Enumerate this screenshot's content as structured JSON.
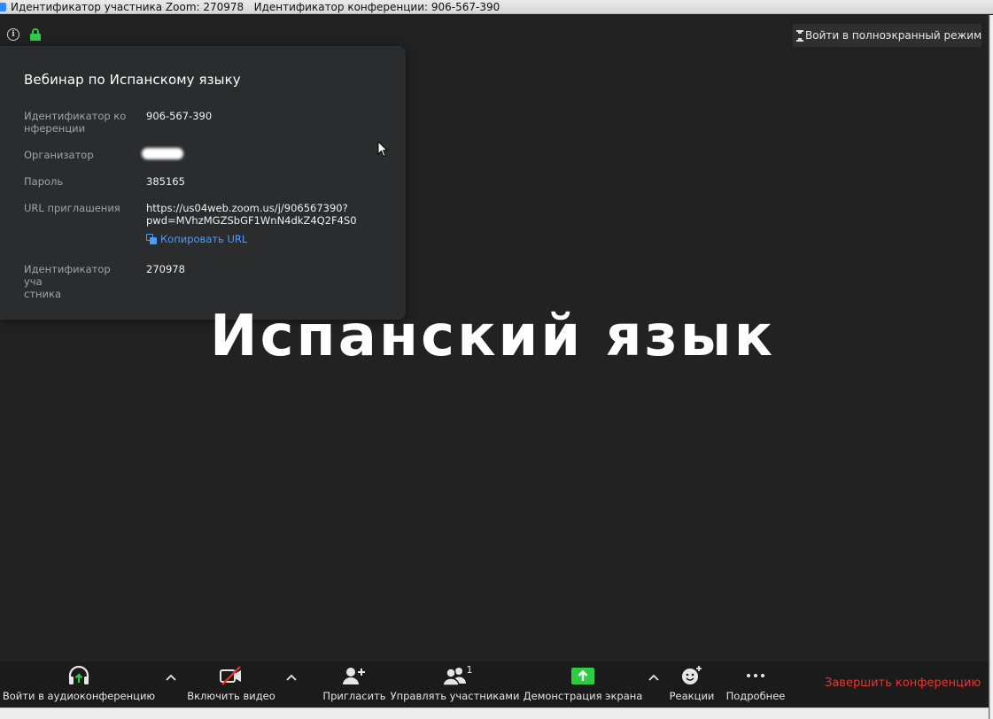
{
  "window": {
    "title": "Идентификатор участника Zoom: 270978   Идентификатор конференции: 906-567-390"
  },
  "top_bar": {
    "fullscreen_label": "Войти в полноэкранный режим"
  },
  "info_panel": {
    "title": "Вебинар по Испанскому языку",
    "meeting_id_label": "Идентификатор ко\nнференции",
    "meeting_id_value": "906-567-390",
    "host_label": "Организатор",
    "password_label": "Пароль",
    "password_value": "385165",
    "invite_url_label": "URL приглашения",
    "invite_url_value": "https://us04web.zoom.us/j/906567390?\npwd=MVhzMGZSbGF1WnN4dkZ4Q2F4S0",
    "copy_url_label": "Копировать URL",
    "participant_id_label": "Идентификатор уча\nстника",
    "participant_id_value": "270978"
  },
  "shared_screen": {
    "text": "Испанский язык"
  },
  "toolbar": {
    "audio_label": "Войти в аудиоконференцию",
    "video_label": "Включить видео",
    "invite_label": "Пригласить",
    "participants_label": "Управлять участниками",
    "participants_count": "1",
    "share_label": "Демонстрация экрана",
    "reactions_label": "Реакции",
    "more_label": "Подробнее",
    "end_label": "Завершить конференцию"
  },
  "colors": {
    "accent_green": "#34c84a",
    "link_blue": "#4a9bff",
    "end_red": "#e8332f",
    "share_green": "#2ecc40"
  }
}
